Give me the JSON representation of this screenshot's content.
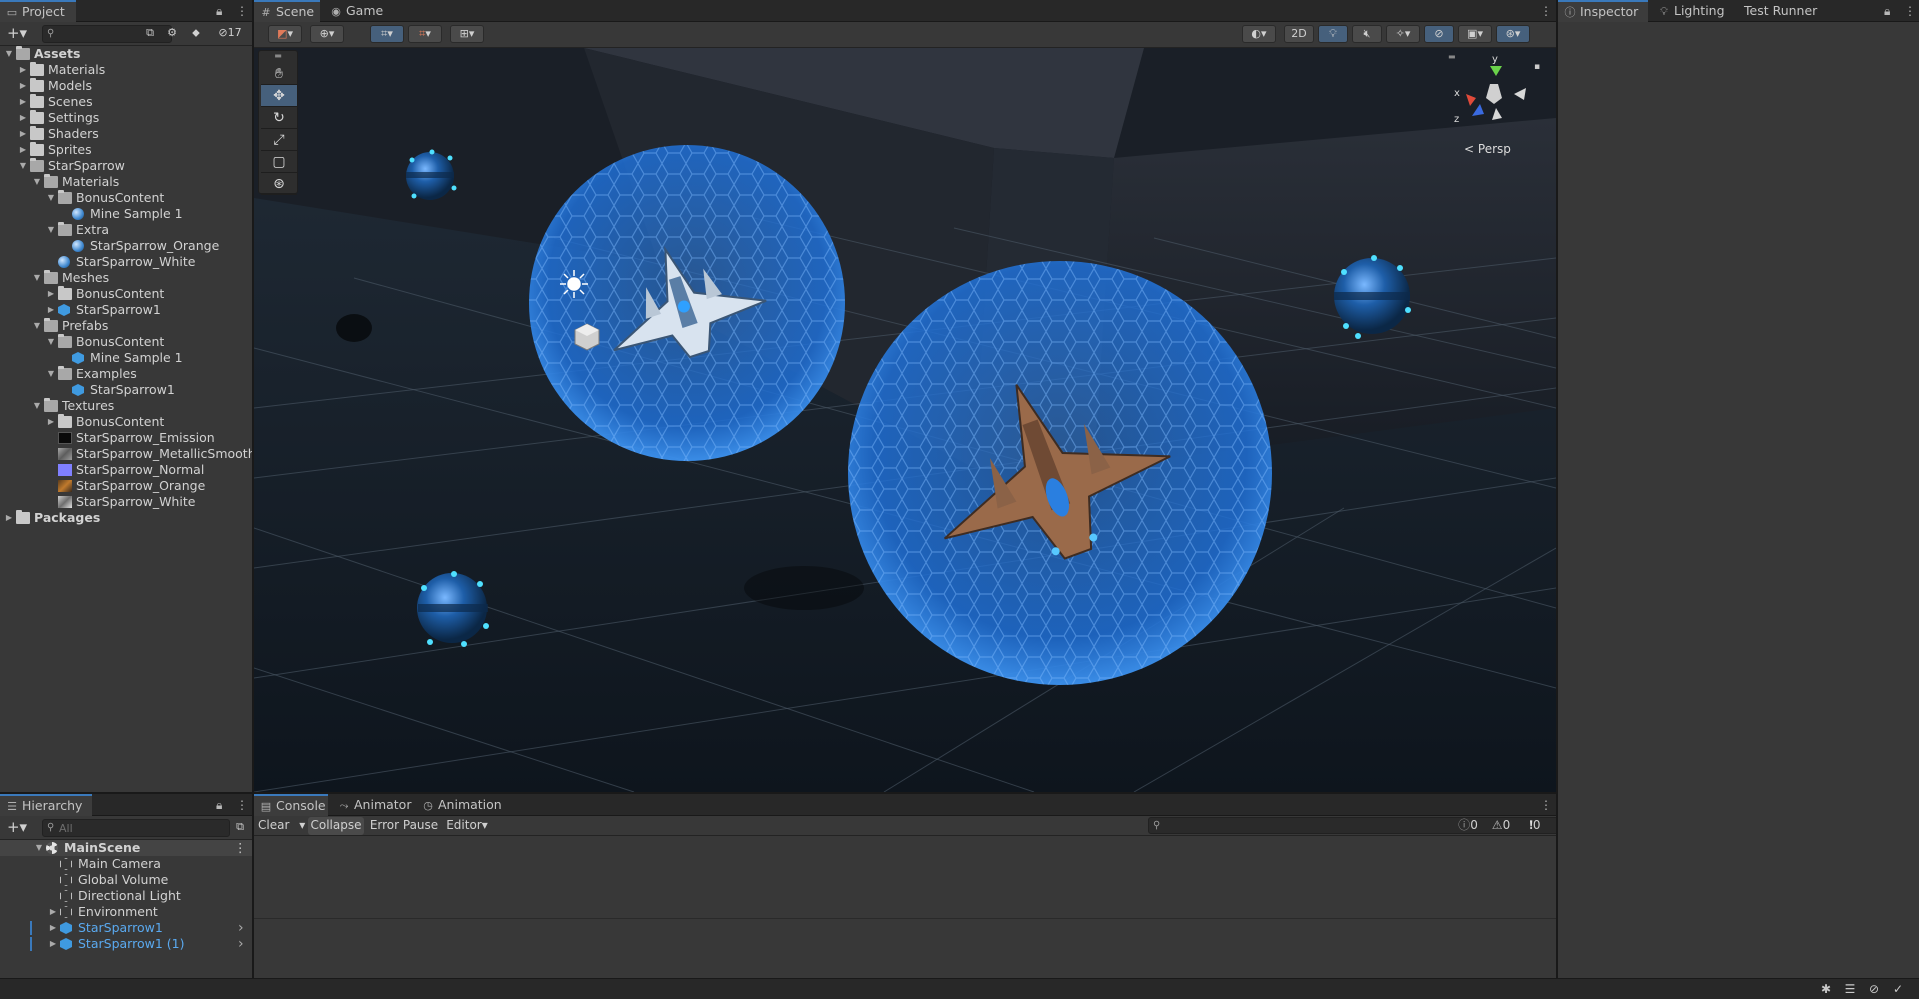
{
  "project": {
    "tab": "Project",
    "search_placeholder": "",
    "hidden_count": "17",
    "tree": [
      {
        "label": "Assets",
        "bold": true
      },
      {
        "label": "Materials"
      },
      {
        "label": "Models"
      },
      {
        "label": "Scenes"
      },
      {
        "label": "Settings"
      },
      {
        "label": "Shaders"
      },
      {
        "label": "Sprites"
      },
      {
        "label": "StarSparrow"
      },
      {
        "label": "Materials"
      },
      {
        "label": "BonusContent"
      },
      {
        "label": "Mine Sample 1"
      },
      {
        "label": "Extra"
      },
      {
        "label": "StarSparrow_Orange"
      },
      {
        "label": "StarSparrow_White"
      },
      {
        "label": "Meshes"
      },
      {
        "label": "BonusContent"
      },
      {
        "label": "StarSparrow1"
      },
      {
        "label": "Prefabs"
      },
      {
        "label": "BonusContent"
      },
      {
        "label": "Mine Sample 1"
      },
      {
        "label": "Examples"
      },
      {
        "label": "StarSparrow1"
      },
      {
        "label": "Textures"
      },
      {
        "label": "BonusContent"
      },
      {
        "label": "StarSparrow_Emission"
      },
      {
        "label": "StarSparrow_MetallicSmoothness"
      },
      {
        "label": "StarSparrow_Normal"
      },
      {
        "label": "StarSparrow_Orange"
      },
      {
        "label": "StarSparrow_White"
      },
      {
        "label": "Packages",
        "bold": true
      }
    ]
  },
  "hierarchy": {
    "tab": "Hierarchy",
    "search_placeholder": "All",
    "items": [
      {
        "label": "MainScene"
      },
      {
        "label": "Main Camera"
      },
      {
        "label": "Global Volume"
      },
      {
        "label": "Directional Light"
      },
      {
        "label": "Environment"
      },
      {
        "label": "StarSparrow1"
      },
      {
        "label": "StarSparrow1 (1)"
      }
    ]
  },
  "scene": {
    "tabs": [
      "Scene",
      "Game"
    ],
    "btn_2d": "2D",
    "persp_label": "Persp",
    "gizmo_axes": {
      "x": "x",
      "y": "y",
      "z": "z"
    }
  },
  "bottom": {
    "tabs": [
      "Console",
      "Animator",
      "Animation"
    ],
    "clear": "Clear",
    "collapse": "Collapse",
    "error_pause": "Error Pause",
    "editor": "Editor",
    "counts": {
      "info": "0",
      "warn": "0",
      "error": "0"
    }
  },
  "inspector": {
    "tabs": [
      "Inspector",
      "Lighting",
      "Test Runner"
    ]
  },
  "colors": {
    "accent": "#3a79bb",
    "selection_text": "#5aa9ef",
    "shield": "#1f6fd6"
  }
}
